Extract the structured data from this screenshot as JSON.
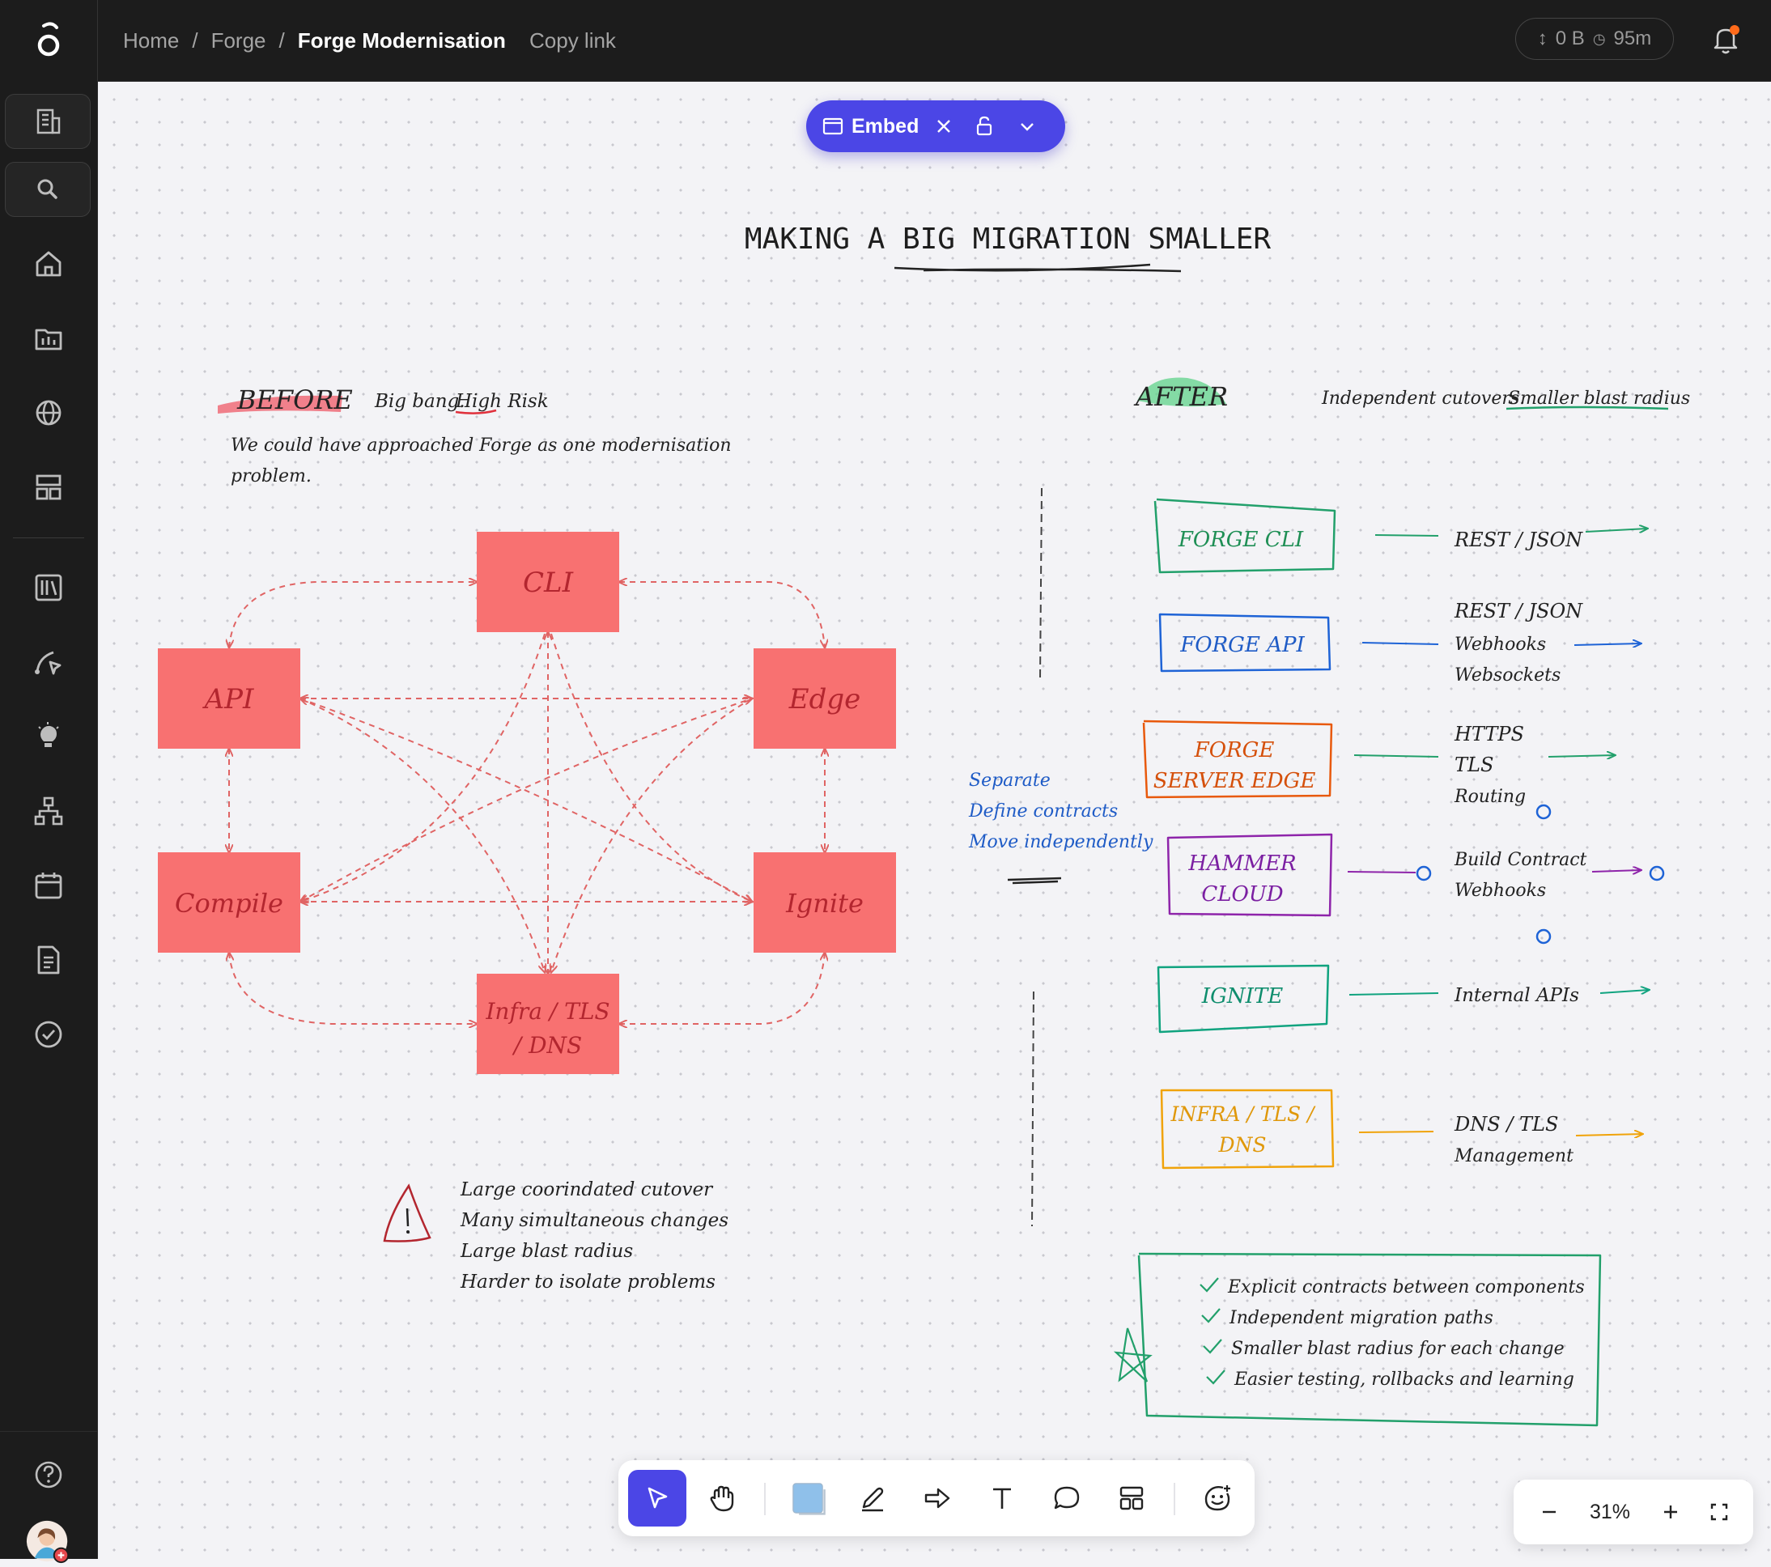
{
  "topbar": {
    "breadcrumbs": [
      "Home",
      "Forge",
      "Forge Modernisation"
    ],
    "separator": "/",
    "copy_link": "Copy link",
    "storage": "0 B",
    "timer": "95m"
  },
  "embed": {
    "label": "Embed"
  },
  "board": {
    "title": "MAKING A BIG MIGRATION SMALLER",
    "before": {
      "tag": "BEFORE",
      "subtitle_a": "Big bang.",
      "subtitle_b": "High Risk",
      "desc_1": "We could have approached Forge as one modernisation",
      "desc_2": "problem.",
      "nodes": [
        "CLI",
        "API",
        "Edge",
        "Compile",
        "Ignite",
        "Infra / TLS",
        "/ DNS"
      ],
      "risks": [
        "Large coorindated cutover",
        "Many simultaneous changes",
        "Large blast radius",
        "Harder to isolate problems"
      ]
    },
    "after": {
      "tag": "AFTER",
      "subtitle_a": "Independent cutovers.",
      "subtitle_b": "Smaller blast radius",
      "notes": [
        "Separate",
        "Define contracts",
        "Move independently"
      ],
      "components": [
        {
          "name": [
            "FORGE CLI"
          ],
          "contracts": [
            "REST / JSON"
          ],
          "color": "#22a06b"
        },
        {
          "name": [
            "FORGE API"
          ],
          "contracts": [
            "REST / JSON",
            "Webhooks",
            "Websockets"
          ],
          "color": "#1e63d6"
        },
        {
          "name": [
            "FORGE",
            "SERVER EDGE"
          ],
          "contracts": [
            "HTTPS",
            "TLS",
            "Routing"
          ],
          "color": "#e8590c"
        },
        {
          "name": [
            "HAMMER",
            "CLOUD"
          ],
          "contracts": [
            "Build Contract",
            "Webhooks"
          ],
          "color": "#8e24aa"
        },
        {
          "name": [
            "IGNITE"
          ],
          "contracts": [
            "Internal APIs"
          ],
          "color": "#10a37f"
        },
        {
          "name": [
            "INFRA / TLS /",
            "DNS"
          ],
          "contracts": [
            "DNS / TLS",
            "Management"
          ],
          "color": "#f0a30a"
        }
      ],
      "benefits": [
        "Explicit contracts between components",
        "Independent migration paths",
        "Smaller blast radius for each change",
        "Easier testing, rollbacks and learning"
      ]
    }
  },
  "zoom": {
    "level": "31%"
  },
  "colors": {
    "accent": "#4b46e6",
    "before_node": "#f87171",
    "topbar": "#1c1c1c"
  }
}
